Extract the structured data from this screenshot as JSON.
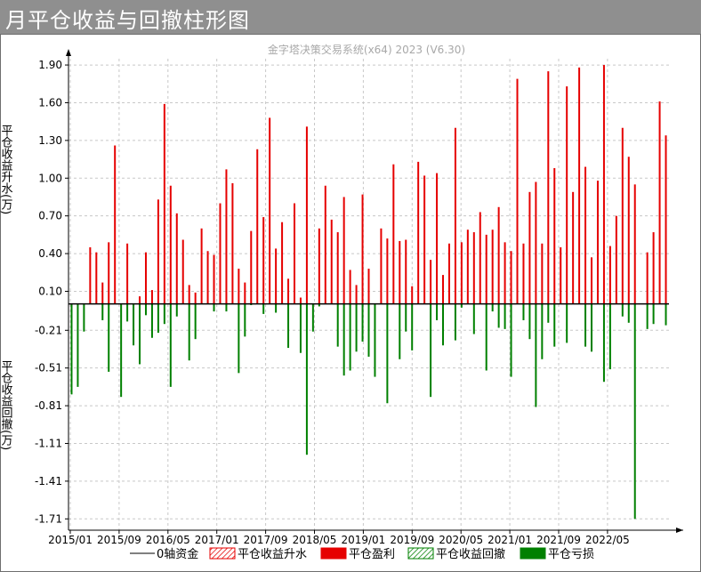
{
  "window": {
    "title": "月平仓收益与回撤柱形图"
  },
  "chart_data": {
    "type": "bar",
    "watermark": "金字塔决策交易系统(x64) 2023 (V6.30)",
    "ylabel_top": "平仓收益升水(万)",
    "ylabel_bottom": "平仓收益回撤(万)",
    "y_ticks": [
      "1.90",
      "1.60",
      "1.30",
      "1.00",
      "0.70",
      "0.40",
      "0.10",
      "-0.21",
      "-0.51",
      "-0.81",
      "-1.11",
      "-1.41",
      "-1.71"
    ],
    "x_ticks": [
      "2015/01",
      "2015/09",
      "2016/05",
      "2017/01",
      "2017/09",
      "2018/05",
      "2019/01",
      "2019/09",
      "2020/05",
      "2021/01",
      "2021/09",
      "2022/05"
    ],
    "ylim": [
      -1.8,
      1.95
    ],
    "grid": true,
    "legend_position": "bottom",
    "legend": [
      "0轴资金",
      "平仓收益升水",
      "平仓盈利",
      "平仓收益回撤",
      "平仓亏损"
    ],
    "colors": {
      "profit": "#e60000",
      "loss": "#008000",
      "axis": "#000000",
      "grid": "#c8c8c8"
    },
    "series": [
      {
        "name": "平仓盈利",
        "values": [
          0,
          0,
          0,
          0.45,
          0.41,
          0.17,
          0.49,
          1.26,
          0,
          0.48,
          0,
          0.06,
          0.41,
          0.11,
          0.83,
          1.59,
          0.94,
          0.72,
          0.51,
          0.15,
          0.09,
          0.6,
          0.42,
          0.39,
          0.8,
          1.07,
          0.96,
          0.28,
          0.17,
          0.58,
          1.23,
          0.69,
          1.48,
          0.44,
          0.65,
          0.2,
          0.8,
          0.05,
          1.41,
          0,
          0.6,
          0.94,
          0.67,
          0.57,
          0.85,
          0.27,
          0.15,
          0.87,
          0.28,
          0,
          0.6,
          0.52,
          1.11,
          0.5,
          0.51,
          0.14,
          1.13,
          1.02,
          0.35,
          1.04,
          0.23,
          0.48,
          1.4,
          0.49,
          0.59,
          0.57,
          0.73,
          0.55,
          0.59,
          0.77,
          0.49,
          0.42,
          1.79,
          0.48,
          0.89,
          0.97,
          0.48,
          1.85,
          1.08,
          0.45,
          1.73,
          0.89,
          1.88,
          1.09,
          0.37,
          0.98,
          1.9,
          0.46,
          0.7,
          1.4,
          1.17,
          0.95,
          0,
          0.41,
          0.57,
          1.61,
          1.34
        ]
      },
      {
        "name": "平仓亏损",
        "values": [
          -0.72,
          -0.66,
          -0.22,
          0,
          0,
          -0.13,
          -0.54,
          0,
          -0.74,
          -0.14,
          -0.33,
          -0.48,
          -0.09,
          -0.27,
          -0.23,
          -0.16,
          -0.66,
          -0.1,
          0,
          -0.45,
          -0.28,
          0,
          0,
          -0.06,
          0,
          -0.06,
          0,
          -0.55,
          -0.26,
          -0.01,
          0,
          -0.08,
          0,
          -0.07,
          0,
          -0.35,
          0,
          -0.39,
          -1.2,
          -0.22,
          -0.02,
          0,
          0,
          -0.34,
          -0.57,
          -0.53,
          -0.38,
          -0.3,
          -0.42,
          -0.58,
          0,
          -0.79,
          0,
          -0.44,
          -0.22,
          -0.37,
          0,
          0,
          -0.74,
          -0.13,
          -0.33,
          0,
          -0.29,
          -0.03,
          0,
          -0.24,
          0,
          -0.53,
          -0.06,
          -0.19,
          -0.2,
          -0.58,
          0,
          -0.13,
          -0.28,
          -0.82,
          -0.44,
          -0.15,
          -0.34,
          0,
          -0.31,
          0,
          0,
          -0.34,
          -0.38,
          0,
          -0.62,
          -0.52,
          0,
          -0.1,
          -0.15,
          -1.71,
          0,
          -0.2,
          -0.16,
          0,
          -0.17
        ]
      }
    ]
  }
}
